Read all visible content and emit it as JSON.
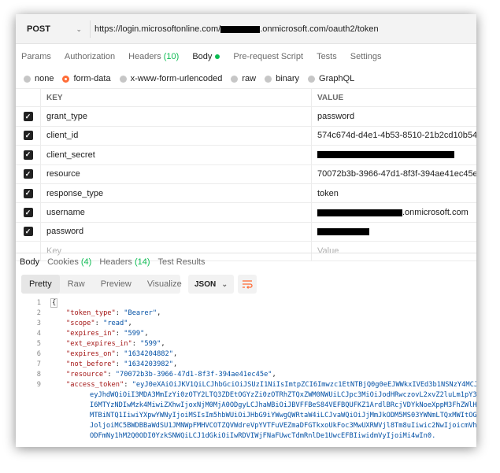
{
  "request": {
    "method": "POST",
    "url_prefix": "https://login.microsoftonline.com/",
    "url_suffix": ".onmicrosoft.com/oauth2/token"
  },
  "request_tabs": [
    {
      "label": "Params",
      "count": ""
    },
    {
      "label": "Authorization",
      "count": ""
    },
    {
      "label": "Headers",
      "count": "(10)"
    },
    {
      "label": "Body",
      "count": ""
    },
    {
      "label": "Pre-request Script",
      "count": ""
    },
    {
      "label": "Tests",
      "count": ""
    },
    {
      "label": "Settings",
      "count": ""
    }
  ],
  "body_types": [
    "none",
    "form-data",
    "x-www-form-urlencoded",
    "raw",
    "binary",
    "GraphQL"
  ],
  "params": {
    "header_key": "KEY",
    "header_value": "VALUE",
    "rows": [
      {
        "key": "grant_type",
        "value": "password"
      },
      {
        "key": "client_id",
        "value": "574c674d-d4e1-4b53-8510-21b2cd10b545"
      },
      {
        "key": "client_secret",
        "value": ""
      },
      {
        "key": "resource",
        "value": "70072b3b-3966-47d1-8f3f-394ae41ec45e"
      },
      {
        "key": "response_type",
        "value": "token"
      },
      {
        "key": "username",
        "value": ".onmicrosoft.com"
      },
      {
        "key": "password",
        "value": ""
      }
    ],
    "placeholder_key": "Key",
    "placeholder_value": "Value"
  },
  "response_tabs": [
    {
      "label": "Body",
      "count": ""
    },
    {
      "label": "Cookies",
      "count": "(4)"
    },
    {
      "label": "Headers",
      "count": "(14)"
    },
    {
      "label": "Test Results",
      "count": ""
    }
  ],
  "view_modes": [
    "Pretty",
    "Raw",
    "Preview",
    "Visualize"
  ],
  "format": "JSON",
  "code": {
    "line_numbers": [
      "1",
      "2",
      "3",
      "4",
      "5",
      "6",
      "7",
      "8",
      "9"
    ],
    "open_brace": "{",
    "pairs": [
      {
        "key": "\"token_type\"",
        "value": "\"Bearer\""
      },
      {
        "key": "\"scope\"",
        "value": "\"read\""
      },
      {
        "key": "\"expires_in\"",
        "value": "\"599\""
      },
      {
        "key": "\"ext_expires_in\"",
        "value": "\"599\""
      },
      {
        "key": "\"expires_on\"",
        "value": "\"1634204882\""
      },
      {
        "key": "\"not_before\"",
        "value": "\"1634203982\""
      },
      {
        "key": "\"resource\"",
        "value": "\"70072b3b-3966-47d1-8f3f-394ae41ec45e\""
      }
    ],
    "token_key": "\"access_token\"",
    "token_lines": [
      "\"eyJ0eXAiOiJKV1QiLCJhbGciOiJSUzI1NiIsImtpZCI6Imwzc1EtNTBjQ0g0eEJWWkxIVEd3b1NSNzY4MCJ9.",
      "eyJhdWQiOiI3MDA3MmIzYi0zOTY2LTQ3ZDEtOGYzZi0zOTRhZTQxZWM0NWUiLCJpc3MiOiJodHRwczovL2xvZ2luLm1pY3Jvc29mdG9",
      "I6MTYzNDIwMzk4MiwiZXhwIjoxNjM0MjA0ODgyLCJhaWBiOiJBVFFBeS84VEFBQUFKZ1ArdlBRcjVDYkNoeXppM3FhZWlHWHJmaFQwc",
      "MTBiNTQ1IiwiYXpwYWNyIjoiMSIsIm5hbWUiOiJHbG9iYWwgQWRtaW4iLCJvaWQiOiJjMmJkODM5MS03YWNmLTQxMWItOGVjYi04OWQ",
      "JoljoiMC5BWDBBaWdSU1JMNWpFMHVCOTZQVWdreVpYVTFuVEZmaDFGTkxoUkFoc3MwUXRWVjl8Tm8uIiwic2NwIjoicmVhZCIsInN1Y",
      "ODFmNy1hM2Q0ODI0YzkSNWQiLCJ1dGkiOiIwRDVIWjFNaFUwcTdmRnlDe1UwcEFBIiwidmVyIjoiMi4wIn0."
    ]
  }
}
